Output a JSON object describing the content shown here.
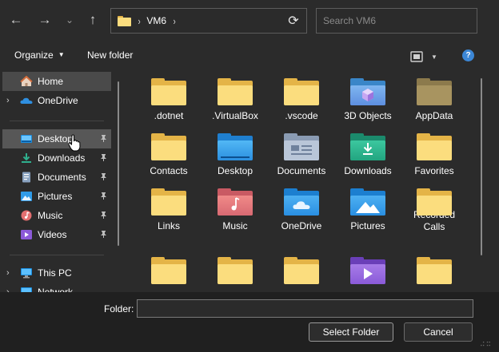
{
  "nav": {
    "back_glyph": "←",
    "forward_glyph": "→",
    "recent_glyph": "⌄",
    "up_glyph": "↑",
    "refresh_glyph": "⟳"
  },
  "address": {
    "separator": "›",
    "crumbs": [
      "VM6"
    ],
    "trailing_separator": "›"
  },
  "search": {
    "placeholder": "Search VM6"
  },
  "toolbar": {
    "organize_label": "Organize",
    "new_folder_label": "New folder",
    "caret": "▼",
    "help_glyph": "?"
  },
  "sidebar": {
    "items": [
      {
        "label": "Home",
        "icon": "home-icon"
      },
      {
        "label": "OneDrive",
        "icon": "cloud-icon",
        "expander": "›"
      },
      {
        "label": "Desktop",
        "icon": "desktop-icon",
        "pinned": true
      },
      {
        "label": "Downloads",
        "icon": "download-icon",
        "pinned": true
      },
      {
        "label": "Documents",
        "icon": "documents-icon",
        "pinned": true
      },
      {
        "label": "Pictures",
        "icon": "pictures-icon",
        "pinned": true
      },
      {
        "label": "Music",
        "icon": "music-icon",
        "pinned": true
      },
      {
        "label": "Videos",
        "icon": "videos-icon",
        "pinned": true
      },
      {
        "label": "This PC",
        "icon": "computer-icon",
        "expander": "›"
      },
      {
        "label": "Network",
        "icon": "network-icon",
        "expander": "›"
      }
    ],
    "pin_glyph": "📌"
  },
  "files": [
    {
      "name": ".dotnet",
      "icon": "folder-icon"
    },
    {
      "name": ".VirtualBox",
      "icon": "folder-icon"
    },
    {
      "name": ".vscode",
      "icon": "folder-icon"
    },
    {
      "name": "3D Objects",
      "icon": "3d-objects-folder-icon"
    },
    {
      "name": "AppData",
      "icon": "folder-dim-icon"
    },
    {
      "name": "Contacts",
      "icon": "folder-icon"
    },
    {
      "name": "Desktop",
      "icon": "desktop-folder-icon"
    },
    {
      "name": "Documents",
      "icon": "documents-folder-icon"
    },
    {
      "name": "Downloads",
      "icon": "downloads-folder-icon"
    },
    {
      "name": "Favorites",
      "icon": "folder-icon"
    },
    {
      "name": "Links",
      "icon": "folder-icon"
    },
    {
      "name": "Music",
      "icon": "music-folder-icon"
    },
    {
      "name": "OneDrive",
      "icon": "onedrive-folder-icon"
    },
    {
      "name": "Pictures",
      "icon": "pictures-folder-icon"
    },
    {
      "name": "Recorded Calls",
      "icon": "folder-icon"
    },
    {
      "name": "",
      "icon": "folder-icon"
    },
    {
      "name": "",
      "icon": "folder-icon"
    },
    {
      "name": "",
      "icon": "folder-icon"
    },
    {
      "name": "",
      "icon": "videos-folder-icon"
    },
    {
      "name": "",
      "icon": "folder-icon"
    }
  ],
  "footer": {
    "folder_label": "Folder:",
    "folder_value": "",
    "select_label": "Select Folder",
    "cancel_label": "Cancel"
  },
  "colors": {
    "background": "#2b2b2b",
    "footer_bg": "#202020",
    "folder_light": "#fbdd7e",
    "folder_dark": "#e4b447",
    "accent": "#3c87d6"
  }
}
